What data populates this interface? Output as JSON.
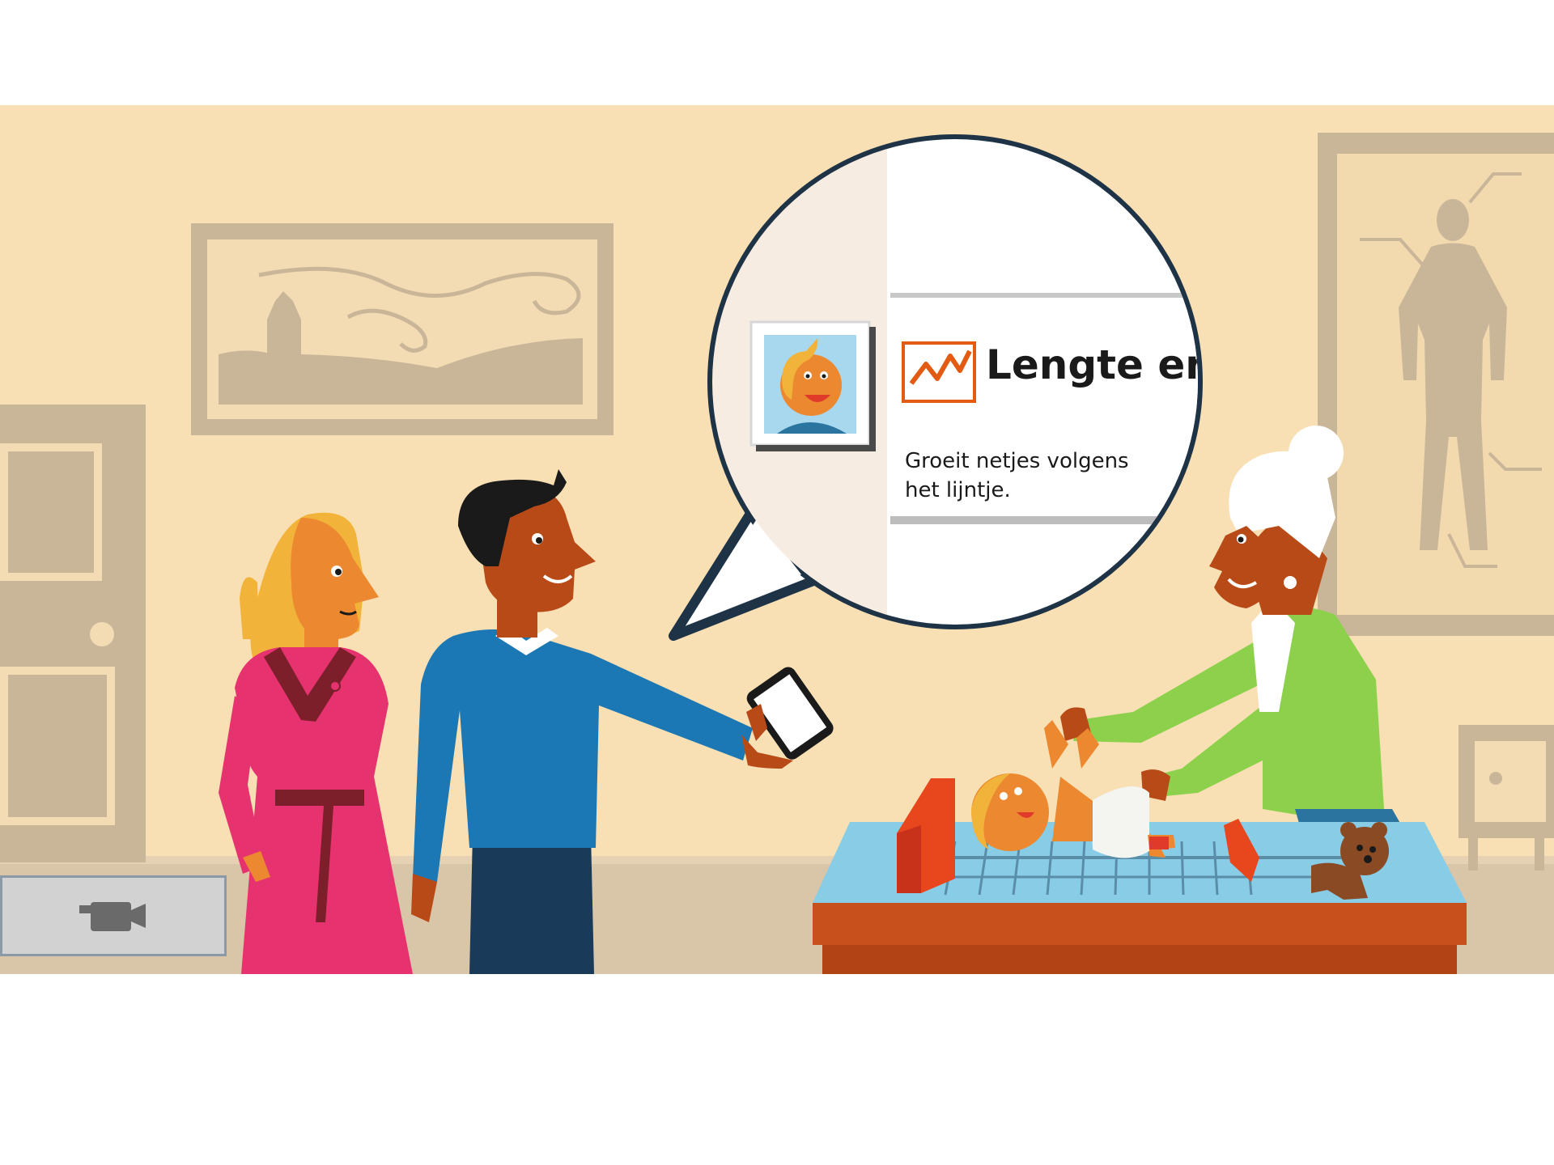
{
  "bubble": {
    "card_title": "Lengte en g",
    "card_text_line1": "Groeit netjes volgens",
    "card_text_line2": "het lijntje."
  },
  "controls": {
    "video_icon": "video-camera-icon"
  },
  "colors": {
    "wall": "#f8e0b4",
    "floor": "#d8c4a6",
    "frame": "#c8b49a",
    "woman_dress": "#e6336f",
    "man_sweater": "#1c78b4",
    "nurse_jacket": "#8cd04c",
    "table_top": "#88cce6",
    "table_base": "#c8501c",
    "accent_chart": "#e35b12"
  }
}
